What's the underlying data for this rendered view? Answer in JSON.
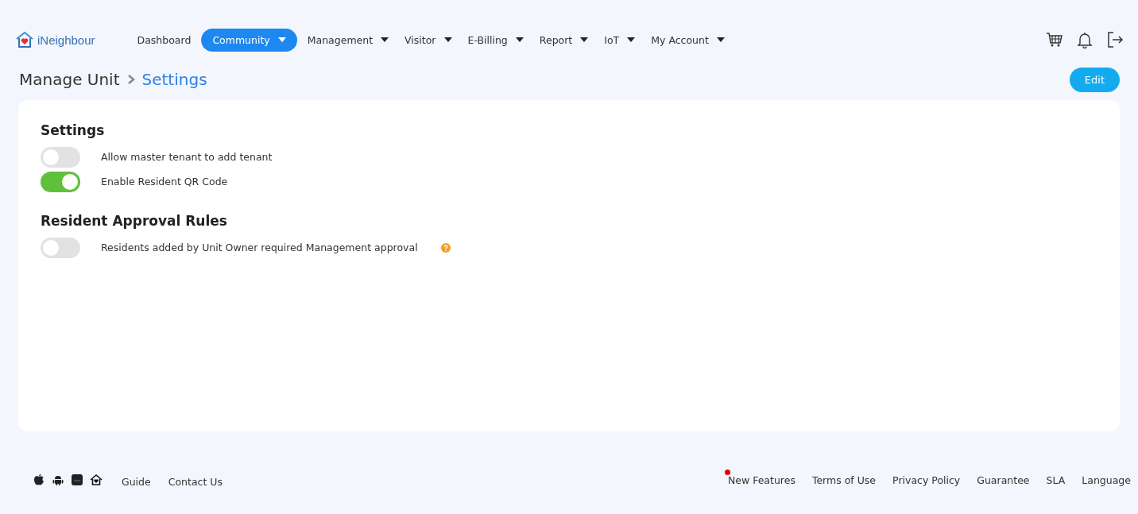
{
  "brand": {
    "name": "iNeighbour"
  },
  "nav": [
    {
      "label": "Dashboard",
      "dropdown": false,
      "selected": false
    },
    {
      "label": "Community",
      "dropdown": true,
      "selected": true
    },
    {
      "label": "Management",
      "dropdown": true,
      "selected": false
    },
    {
      "label": "Visitor",
      "dropdown": true,
      "selected": false
    },
    {
      "label": "E-Billing",
      "dropdown": true,
      "selected": false
    },
    {
      "label": "Report",
      "dropdown": true,
      "selected": false
    },
    {
      "label": "IoT",
      "dropdown": true,
      "selected": false
    },
    {
      "label": "My Account",
      "dropdown": true,
      "selected": false
    }
  ],
  "breadcrumb": [
    "Manage Unit",
    "Settings"
  ],
  "edit_button": "Edit",
  "sections": [
    {
      "title": "Settings",
      "toggles": [
        {
          "label": "Allow master tenant to add tenant",
          "on": false,
          "help": false
        },
        {
          "label": "Enable Resident QR Code",
          "on": true,
          "help": false
        }
      ]
    },
    {
      "title": "Resident Approval Rules",
      "toggles": [
        {
          "label": "Residents added by Unit Owner required Management approval",
          "on": false,
          "help": true
        }
      ]
    }
  ],
  "footer": {
    "left_links": [
      "Guide",
      "Contact Us"
    ],
    "right_links": [
      {
        "label": "New Features",
        "dot": true
      },
      {
        "label": "Terms of Use",
        "dot": false
      },
      {
        "label": "Privacy Policy",
        "dot": false
      },
      {
        "label": "Guarantee",
        "dot": false
      },
      {
        "label": "SLA",
        "dot": false
      },
      {
        "label": "Language",
        "dot": false
      }
    ]
  }
}
